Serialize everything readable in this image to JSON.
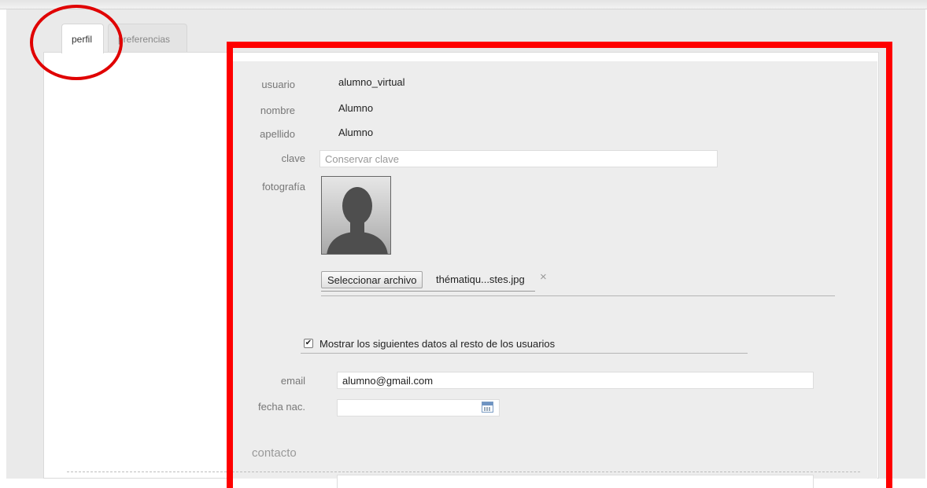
{
  "tabs": [
    {
      "label": "perfil",
      "active": true
    },
    {
      "label": "preferencias",
      "active": false
    }
  ],
  "profile": {
    "usuario": {
      "label": "usuario",
      "value": "alumno_virtual"
    },
    "nombre": {
      "label": "nombre",
      "value": "Alumno"
    },
    "apellido": {
      "label": "apellido",
      "value": "Alumno"
    },
    "clave": {
      "label": "clave",
      "placeholder": "Conservar clave"
    },
    "fotografia": {
      "label": "fotografía"
    }
  },
  "file": {
    "button_label": "Seleccionar archivo",
    "filename": "thématiqu...stes.jpg",
    "clear_icon": "×"
  },
  "share": {
    "checked": true,
    "label": "Mostrar los siguientes datos al resto de los usuarios"
  },
  "email": {
    "label": "email",
    "value": "alumno@gmail.com"
  },
  "birthdate": {
    "label": "fecha nac.",
    "value": "",
    "icon": "calendar-icon"
  },
  "section": {
    "contacto": "contacto"
  },
  "annotations": {
    "highlight_color": "#ff0000"
  }
}
